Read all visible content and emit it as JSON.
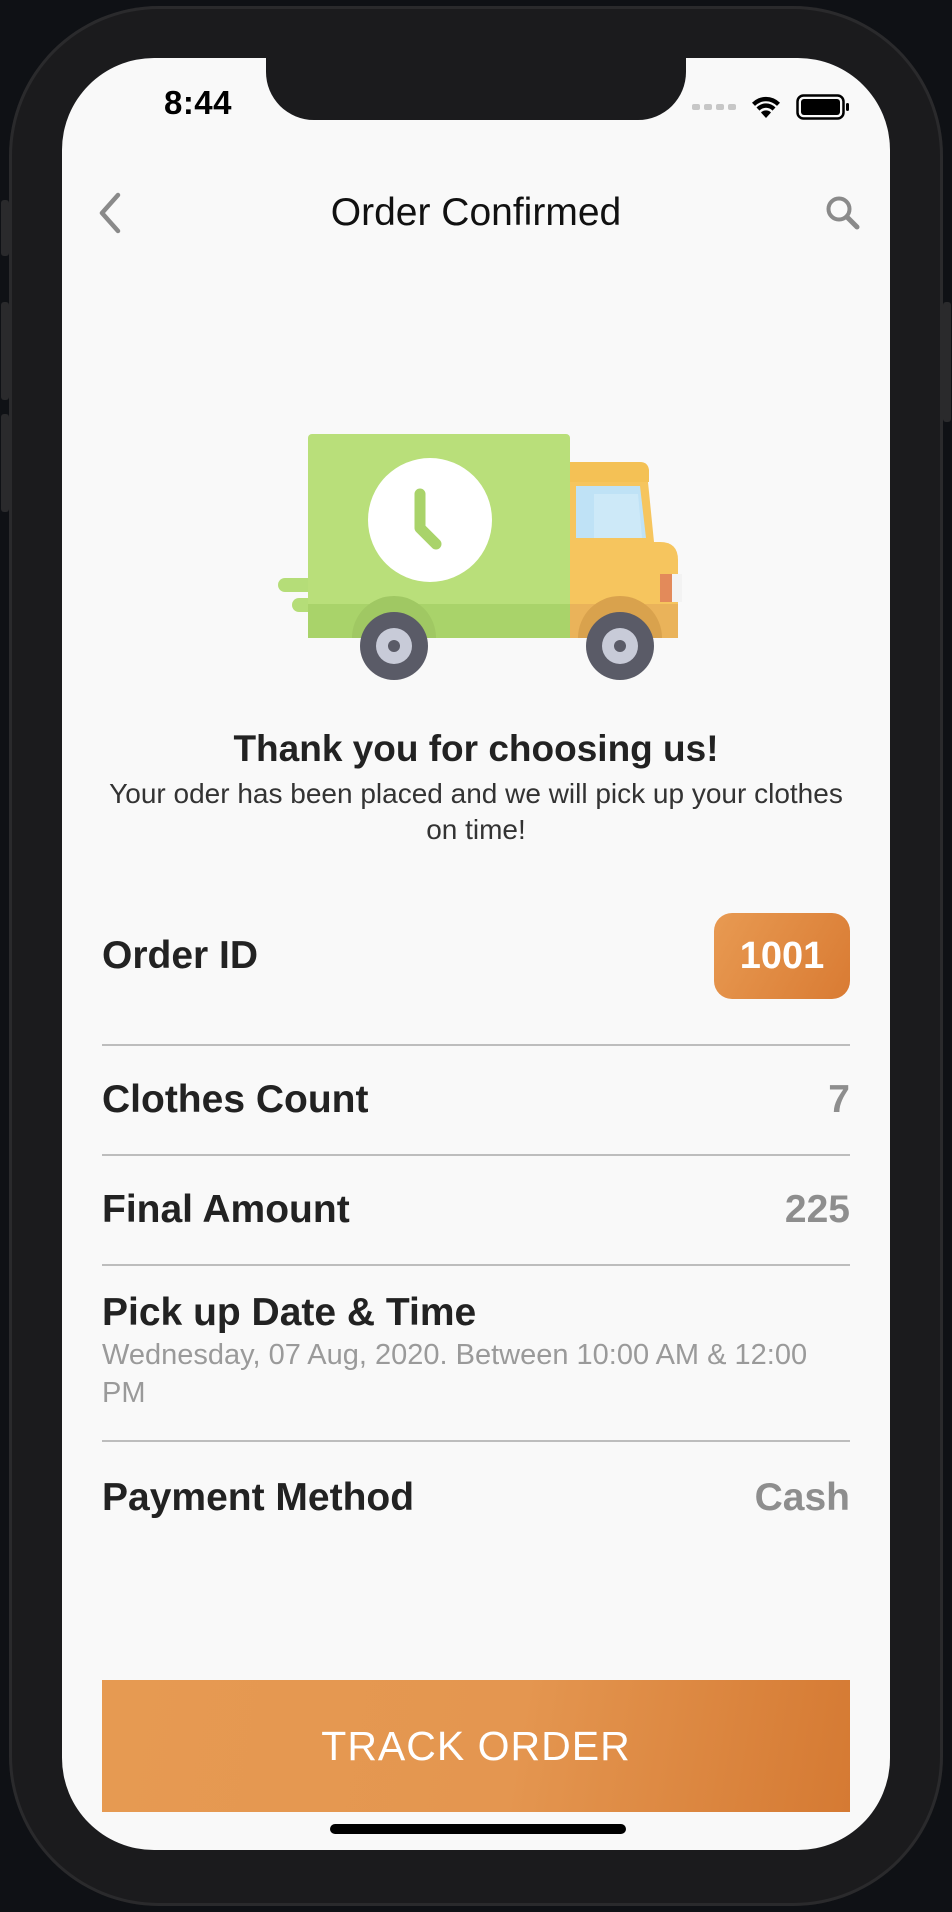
{
  "status_bar": {
    "time": "8:44"
  },
  "nav": {
    "title": "Order Confirmed",
    "back_icon": "chevron-left-icon",
    "search_icon": "search-icon"
  },
  "illustration": {
    "icon": "delivery-truck-clock-icon"
  },
  "message": {
    "title": "Thank you for choosing us!",
    "subtitle": "Your oder has been placed and we will pick up your clothes on time!"
  },
  "order": {
    "id_label": "Order ID",
    "id_value": "1001",
    "clothes_label": "Clothes Count",
    "clothes_value": "7",
    "amount_label": "Final Amount",
    "amount_value": "225",
    "pickup_label": "Pick up Date & Time",
    "pickup_value": "Wednesday, 07 Aug, 2020. Between 10:00 AM & 12:00 PM",
    "payment_label": "Payment Method",
    "payment_value": "Cash"
  },
  "actions": {
    "track_label": "TRACK ORDER"
  },
  "colors": {
    "accent": "#e4934c",
    "accent_dark": "#d57a33",
    "truck_body": "#b5dd78",
    "truck_cab": "#f6c55e"
  }
}
